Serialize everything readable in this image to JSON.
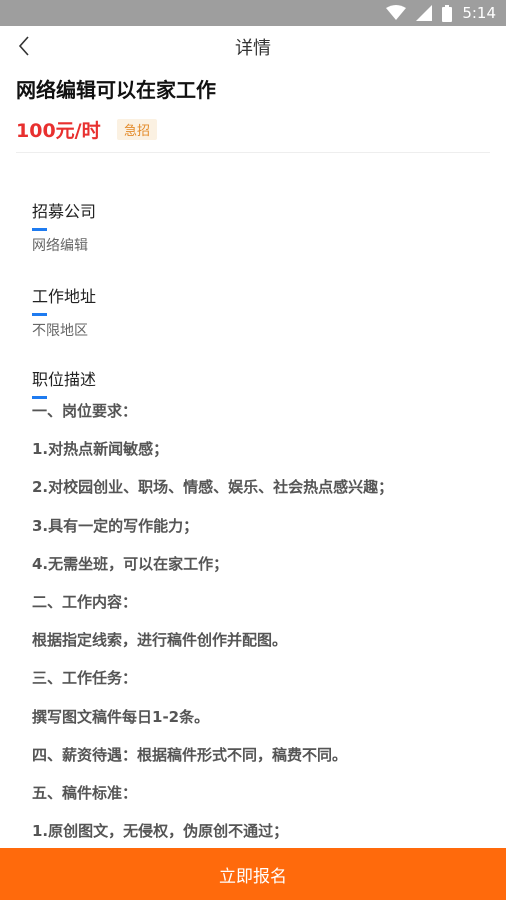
{
  "status_bar": {
    "time": "5:14",
    "background": "#9e9e9e"
  },
  "nav": {
    "title": "详情",
    "back_icon": "chevron-left-icon"
  },
  "job": {
    "title": "网络编辑可以在家工作",
    "salary": "100元/时",
    "badge": "急招",
    "salary_color": "#e8302f"
  },
  "sections": {
    "company_label": "招募公司",
    "company_value": "网络编辑",
    "address_label": "工作地址",
    "address_value": "不限地区",
    "description_label": "职位描述",
    "accent_color": "#1e7bf0"
  },
  "description": [
    "一、岗位要求：",
    "1.对热点新闻敏感；",
    "2.对校园创业、职场、情感、娱乐、社会热点感兴趣；",
    "3.具有一定的写作能力；",
    "4.无需坐班，可以在家工作；",
    "二、工作内容：",
    "根据指定线索，进行稿件创作并配图。",
    "三、工作任务：",
    "撰写图文稿件每日1-2条。",
    "四、薪资待遇：根据稿件形式不同，稿费不同。",
    "五、稿件标准：",
    "1.原创图文，无侵权，伪原创不通过；"
  ],
  "footer": {
    "apply_label": "立即报名",
    "button_color": "#ff6a0c"
  }
}
